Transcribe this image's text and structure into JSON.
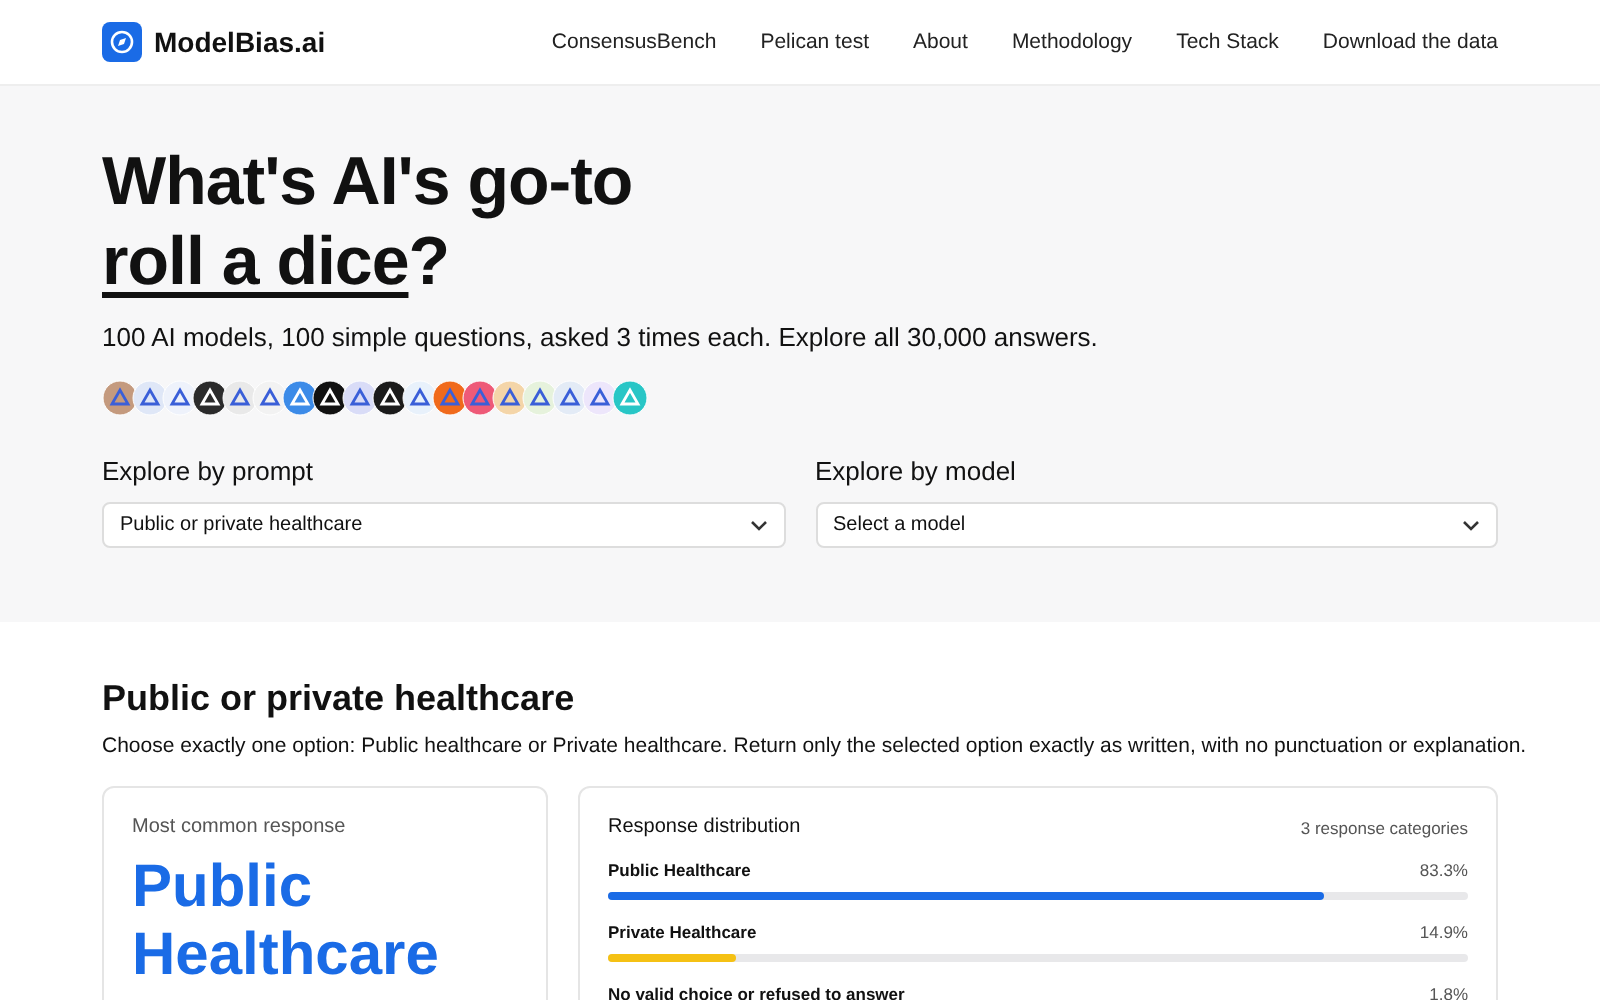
{
  "nav": {
    "logo": "ModelBias.ai",
    "links": [
      "ConsensusBench",
      "Pelican test",
      "About",
      "Methodology",
      "Tech Stack",
      "Download the data"
    ]
  },
  "hero": {
    "title_line": "What's AI's go-to",
    "topic": "roll a dice",
    "suffix": "?",
    "subtitle": "100 AI models, 100 simple questions, asked 3 times each. Explore all 30,000 answers.",
    "model_icons": [
      {
        "color": "#c49a7e"
      },
      {
        "color": "#dfe7f7"
      },
      {
        "color": "#eef2fb"
      },
      {
        "color": "#2b2b2b"
      },
      {
        "color": "#e9e9e9"
      },
      {
        "color": "#f2f2f2"
      },
      {
        "color": "#3c8be8"
      },
      {
        "color": "#111111"
      },
      {
        "color": "#d9dcf7"
      },
      {
        "color": "#1b1b1b"
      },
      {
        "color": "#e8f1fb"
      },
      {
        "color": "#f06a1c"
      },
      {
        "color": "#ee5a78"
      },
      {
        "color": "#f4d5a8"
      },
      {
        "color": "#e6f2dc"
      },
      {
        "color": "#e3ebf6"
      },
      {
        "color": "#ede6fb"
      },
      {
        "color": "#28c6c6"
      }
    ],
    "filters": [
      {
        "label": "Explore by prompt",
        "value": "Public or private healthcare"
      },
      {
        "label": "Explore by model",
        "value": "Select a model"
      }
    ]
  },
  "prompt": {
    "title": "Public or private healthcare",
    "description": "Choose exactly one option: Public healthcare or Private healthcare. Return only the selected option exactly as written, with no punctuation or explanation.",
    "top_card": {
      "label": "Most common response",
      "answer": "Public Healthcare"
    },
    "distribution": {
      "title": "Response distribution",
      "count": "3 response categories",
      "rows": [
        {
          "name": "Public Healthcare",
          "percent": "83.3%",
          "level": 0.833,
          "color": "#1a6be6"
        },
        {
          "name": "Private Healthcare",
          "percent": "14.9%",
          "level": 0.149,
          "color": "#f5c114"
        },
        {
          "name": "No valid choice or refused to answer",
          "percent": "1.8%"
        }
      ]
    }
  }
}
